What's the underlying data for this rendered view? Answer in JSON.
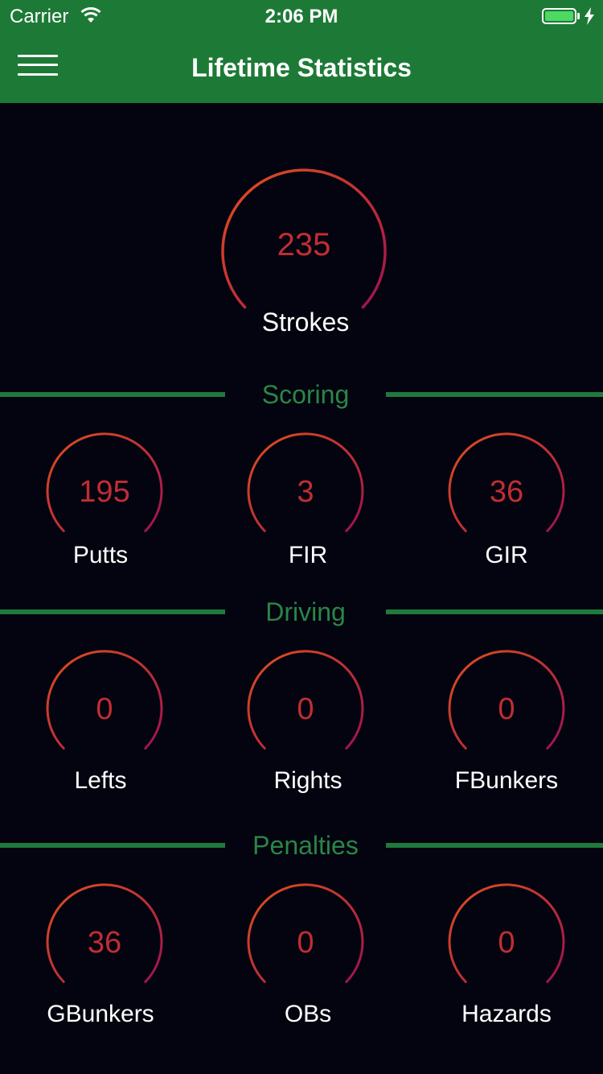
{
  "status_bar": {
    "carrier": "Carrier",
    "time": "2:06 PM"
  },
  "header": {
    "title": "Lifetime Statistics",
    "menu_icon": "hamburger-menu-icon"
  },
  "colors": {
    "header_green": "#1d7a36",
    "section_green": "#2b8547",
    "background": "#03040f",
    "value_red": "#c12d34",
    "gauge_start": "#e0501c",
    "gauge_end": "#9e1150"
  },
  "main_stat": {
    "value": "235",
    "label": "Strokes"
  },
  "sections": [
    {
      "title": "Scoring",
      "stats": [
        {
          "value": "195",
          "label": "Putts"
        },
        {
          "value": "3",
          "label": "FIR"
        },
        {
          "value": "36",
          "label": "GIR"
        }
      ]
    },
    {
      "title": "Driving",
      "stats": [
        {
          "value": "0",
          "label": "Lefts"
        },
        {
          "value": "0",
          "label": "Rights"
        },
        {
          "value": "0",
          "label": "FBunkers"
        }
      ]
    },
    {
      "title": "Penalties",
      "stats": [
        {
          "value": "36",
          "label": "GBunkers"
        },
        {
          "value": "0",
          "label": "OBs"
        },
        {
          "value": "0",
          "label": "Hazards"
        }
      ]
    }
  ]
}
